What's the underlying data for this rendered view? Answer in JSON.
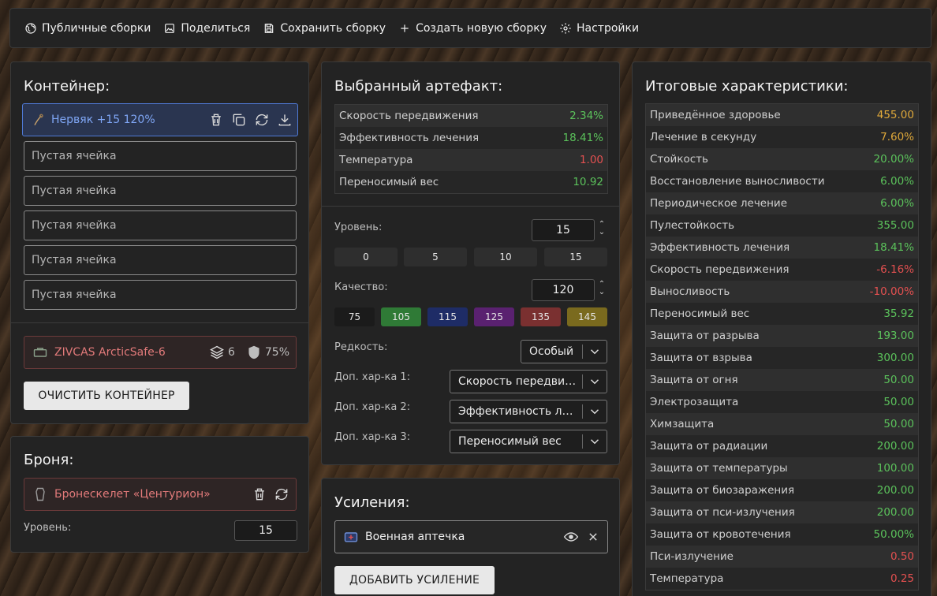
{
  "toolbar": {
    "public_builds": "Публичные сборки",
    "share": "Поделиться",
    "save_build": "Сохранить сборку",
    "new_build": "Создать новую сборку",
    "settings": "Настройки"
  },
  "container": {
    "title": "Контейнер:",
    "artifact_slot": "Нервяк +15 120%",
    "empty_slots": [
      "Пустая ячейка",
      "Пустая ячейка",
      "Пустая ячейка",
      "Пустая ячейка",
      "Пустая ячейка"
    ],
    "container_name": "ZIVCAS ArcticSafe-6",
    "capacity": "6",
    "protection": "75%",
    "clear_button": "ОЧИСТИТЬ КОНТЕЙНЕР"
  },
  "armor": {
    "title": "Броня:",
    "name": "Бронескелет «Центурион»",
    "level_label": "Уровень:",
    "level_value": "15"
  },
  "artifact": {
    "title": "Выбранный артефакт:",
    "stats": [
      {
        "name": "Скорость передвижения",
        "value": "2.34%",
        "color": "g"
      },
      {
        "name": "Эффективность лечения",
        "value": "18.41%",
        "color": "g"
      },
      {
        "name": "Температура",
        "value": "1.00",
        "color": "r"
      },
      {
        "name": "Переносимый вес",
        "value": "10.92",
        "color": "g"
      }
    ],
    "level_label": "Уровень:",
    "level_value": "15",
    "level_presets": [
      "0",
      "5",
      "10",
      "15"
    ],
    "quality_label": "Качество:",
    "quality_value": "120",
    "quality_presets": [
      {
        "label": "75",
        "color": "#1b1b1b"
      },
      {
        "label": "105",
        "color": "#2f7a36"
      },
      {
        "label": "115",
        "color": "#1e2c66"
      },
      {
        "label": "125",
        "color": "#5a2170"
      },
      {
        "label": "135",
        "color": "#7a3030"
      },
      {
        "label": "145",
        "color": "#7a6a1e"
      }
    ],
    "rarity_label": "Редкость:",
    "rarity_value": "Особый",
    "extra1_label": "Доп. хар-ка 1:",
    "extra1_value": "Скорость передвижения",
    "extra2_label": "Доп. хар-ка 2:",
    "extra2_value": "Эффективность лечения",
    "extra3_label": "Доп. хар-ка 3:",
    "extra3_value": "Переносимый вес"
  },
  "boosts": {
    "title": "Усиления:",
    "item": "Военная аптечка",
    "add_button": "ДОБАВИТЬ УСИЛЕНИЕ"
  },
  "totals": {
    "title": "Итоговые характеристики:",
    "rows": [
      {
        "name": "Приведённое здоровье",
        "value": "455.00",
        "color": "o"
      },
      {
        "name": "Лечение в секунду",
        "value": "7.60%",
        "color": "o"
      },
      {
        "name": "Стойкость",
        "value": "20.00%",
        "color": "g"
      },
      {
        "name": "Восстановление выносливости",
        "value": "6.00%",
        "color": "g"
      },
      {
        "name": "Периодическое лечение",
        "value": "6.00%",
        "color": "g"
      },
      {
        "name": "Пулестойкость",
        "value": "355.00",
        "color": "g"
      },
      {
        "name": "Эффективность лечения",
        "value": "18.41%",
        "color": "g"
      },
      {
        "name": "Скорость передвижения",
        "value": "-6.16%",
        "color": "r"
      },
      {
        "name": "Выносливость",
        "value": "-10.00%",
        "color": "r"
      },
      {
        "name": "Переносимый вес",
        "value": "35.92",
        "color": "g"
      },
      {
        "name": "Защита от разрыва",
        "value": "193.00",
        "color": "g"
      },
      {
        "name": "Защита от взрыва",
        "value": "300.00",
        "color": "g"
      },
      {
        "name": "Защита от огня",
        "value": "50.00",
        "color": "g"
      },
      {
        "name": "Электрозащита",
        "value": "50.00",
        "color": "g"
      },
      {
        "name": "Химзащита",
        "value": "50.00",
        "color": "g"
      },
      {
        "name": "Защита от радиации",
        "value": "200.00",
        "color": "g"
      },
      {
        "name": "Защита от температуры",
        "value": "100.00",
        "color": "g"
      },
      {
        "name": "Защита от биозаражения",
        "value": "200.00",
        "color": "g"
      },
      {
        "name": "Защита от пси-излучения",
        "value": "200.00",
        "color": "g"
      },
      {
        "name": "Защита от кровотечения",
        "value": "50.00%",
        "color": "g"
      },
      {
        "name": "Пси-излучение",
        "value": "0.50",
        "color": "r"
      },
      {
        "name": "Температура",
        "value": "0.25",
        "color": "r"
      }
    ]
  }
}
